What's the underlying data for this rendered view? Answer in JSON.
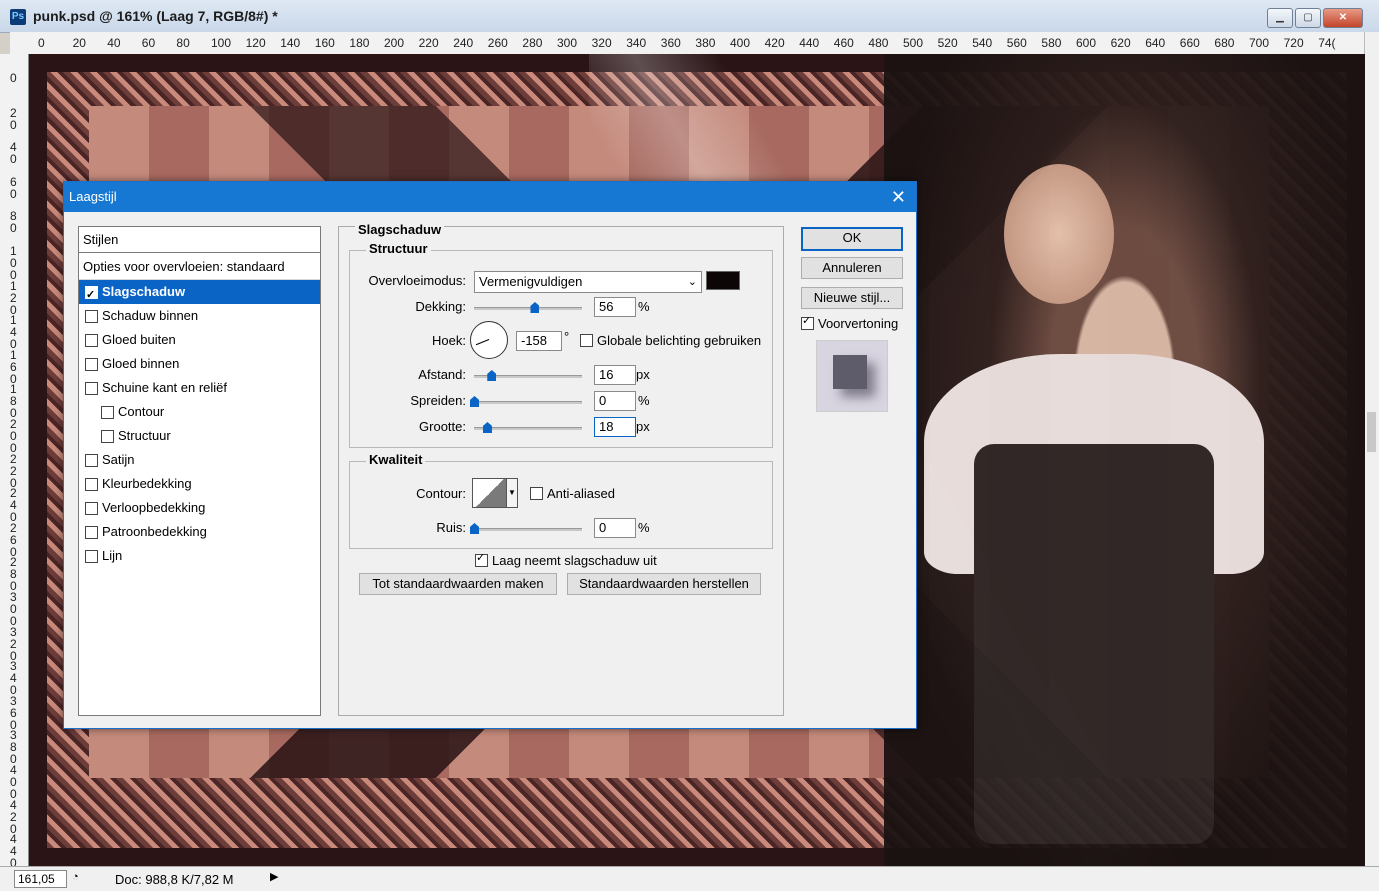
{
  "window": {
    "app_icon": "Ps",
    "title": "punk.psd @ 161% (Laag 7, RGB/8#) *",
    "controls": [
      "minimize-icon",
      "maximize-icon",
      "close-icon"
    ]
  },
  "ruler_top": [
    "0",
    "20",
    "40",
    "60",
    "80",
    "100",
    "120",
    "140",
    "160",
    "180",
    "200",
    "220",
    "240",
    "260",
    "280",
    "300",
    "320",
    "340",
    "360",
    "380",
    "400",
    "420",
    "440",
    "460",
    "480",
    "500",
    "520",
    "540",
    "560",
    "580",
    "600",
    "620",
    "640",
    "660",
    "680",
    "700",
    "720",
    "74("
  ],
  "ruler_left": [
    "0",
    "2 0",
    "4 0",
    "6 0",
    "8 0",
    "1 0 0",
    "1 2 0",
    "1 4 0",
    "1 6 0",
    "1 8 0",
    "2 0 0",
    "2 2 0",
    "2 4 0",
    "2 6 0",
    "2 8 0",
    "3 0 0",
    "3 2 0",
    "3 4 0",
    "3 6 0",
    "3 8 0",
    "4 0 0",
    "4 2 0",
    "4 4 0"
  ],
  "status": {
    "zoom": "161,05",
    "doc": "Doc: 988,8 K/7,82 M"
  },
  "dialog": {
    "title": "Laagstijl",
    "styles_header": "Stijlen",
    "blend_options": "Opties voor overvloeien: standaard",
    "style_items": [
      {
        "label": "Slagschaduw",
        "checked": true,
        "active": true,
        "sub": false
      },
      {
        "label": "Schaduw binnen",
        "checked": false,
        "active": false,
        "sub": false
      },
      {
        "label": "Gloed buiten",
        "checked": false,
        "active": false,
        "sub": false
      },
      {
        "label": "Gloed binnen",
        "checked": false,
        "active": false,
        "sub": false
      },
      {
        "label": "Schuine kant en reliëf",
        "checked": false,
        "active": false,
        "sub": false
      },
      {
        "label": "Contour",
        "checked": false,
        "active": false,
        "sub": true
      },
      {
        "label": "Structuur",
        "checked": false,
        "active": false,
        "sub": true
      },
      {
        "label": "Satijn",
        "checked": false,
        "active": false,
        "sub": false
      },
      {
        "label": "Kleurbedekking",
        "checked": false,
        "active": false,
        "sub": false
      },
      {
        "label": "Verloopbedekking",
        "checked": false,
        "active": false,
        "sub": false
      },
      {
        "label": "Patroonbedekking",
        "checked": false,
        "active": false,
        "sub": false
      },
      {
        "label": "Lijn",
        "checked": false,
        "active": false,
        "sub": false
      }
    ],
    "section_title": "Slagschaduw",
    "structure": {
      "legend": "Structuur",
      "blend_mode_label": "Overvloeimodus:",
      "blend_mode_value": "Vermenigvuldigen",
      "shadow_color": "#0c0606",
      "opacity_label": "Dekking:",
      "opacity_value": "56",
      "opacity_unit": "%",
      "angle_label": "Hoek:",
      "angle_value": "-158",
      "angle_unit": "°",
      "global_light_label": "Globale belichting gebruiken",
      "distance_label": "Afstand:",
      "distance_value": "16",
      "distance_unit": "px",
      "spread_label": "Spreiden:",
      "spread_value": "0",
      "spread_unit": "%",
      "size_label": "Grootte:",
      "size_value": "18",
      "size_unit": "px"
    },
    "quality": {
      "legend": "Kwaliteit",
      "contour_label": "Contour:",
      "antialiased_label": "Anti-aliased",
      "noise_label": "Ruis:",
      "noise_value": "0",
      "noise_unit": "%"
    },
    "knockout_label": "Laag neemt slagschaduw uit",
    "make_default": "Tot standaardwaarden maken",
    "reset_default": "Standaardwaarden herstellen",
    "ok": "OK",
    "cancel": "Annuleren",
    "new_style": "Nieuwe stijl...",
    "preview_label": "Voorvertoning"
  }
}
